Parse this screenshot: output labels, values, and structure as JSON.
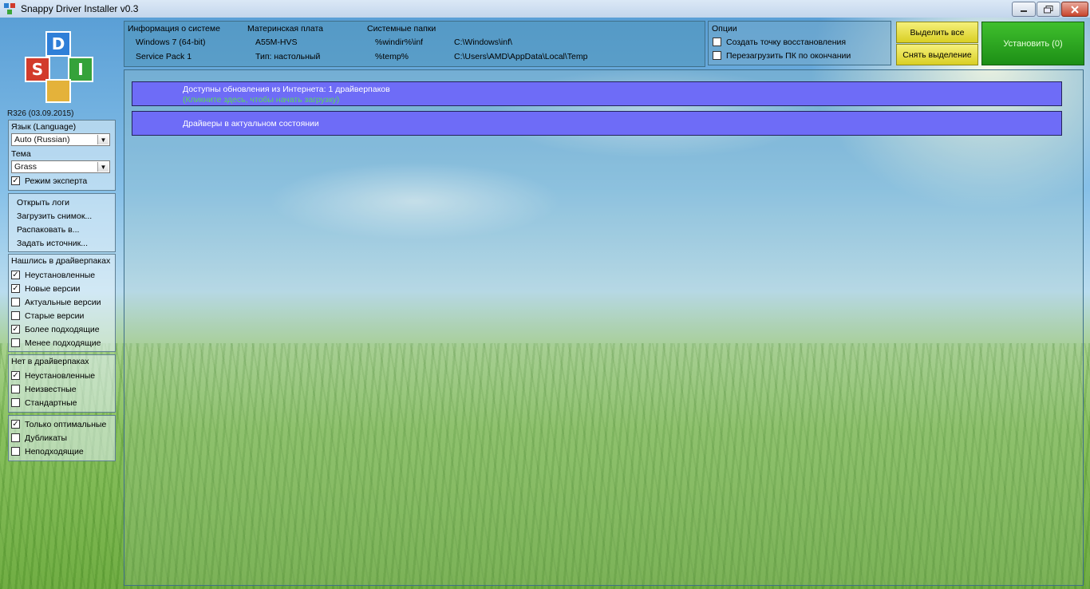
{
  "window": {
    "title": "Snappy Driver Installer v0.3",
    "controls": [
      "minimize",
      "maximize",
      "close"
    ]
  },
  "logo": {
    "letters": [
      "S",
      "D",
      "I"
    ],
    "version": "R326 (03.09.2015)"
  },
  "settings": {
    "language_label": "Язык (Language)",
    "language_value": "Auto (Russian)",
    "theme_label": "Тема",
    "theme_value": "Grass",
    "expert_mode": {
      "label": "Режим эксперта",
      "checked": true
    }
  },
  "actions": {
    "items": [
      "Открыть логи",
      "Загрузить снимок...",
      "Распаковать в...",
      "Задать источник..."
    ]
  },
  "found_in_packs": {
    "title": "Нашлись в драйверпаках",
    "items": [
      {
        "label": "Неустановленные",
        "checked": true
      },
      {
        "label": "Новые версии",
        "checked": true
      },
      {
        "label": "Актуальные версии",
        "checked": false
      },
      {
        "label": "Старые версии",
        "checked": false
      },
      {
        "label": "Более подходящие",
        "checked": true
      },
      {
        "label": "Менее подходящие",
        "checked": false
      }
    ]
  },
  "not_in_packs": {
    "title": "Нет в драйверпаках",
    "items": [
      {
        "label": "Неустановленные",
        "checked": true
      },
      {
        "label": "Неизвестные",
        "checked": false
      },
      {
        "label": "Стандартные",
        "checked": false
      }
    ]
  },
  "extra_filters": {
    "items": [
      {
        "label": "Только оптимальные",
        "checked": true
      },
      {
        "label": "Дубликаты",
        "checked": false
      },
      {
        "label": "Неподходящие",
        "checked": false
      }
    ]
  },
  "system_info": {
    "header_system": "Информация о системе",
    "os": "Windows 7 (64-bit)",
    "service_pack": "Service Pack 1",
    "header_board": "Материнская плата",
    "board": "A55M-HVS",
    "board_type": "Тип: настольный",
    "header_folders": "Системные папки",
    "var_windir": "%windir%\\inf",
    "path_windir": "C:\\Windows\\inf\\",
    "var_temp": "%temp%",
    "path_temp": "C:\\Users\\AMD\\AppData\\Local\\Temp"
  },
  "options": {
    "title": "Опции",
    "items": [
      {
        "label": "Создать точку восстановления",
        "checked": false
      },
      {
        "label": "Перезагрузить ПК по окончании",
        "checked": false
      }
    ]
  },
  "buttons": {
    "select_all": "Выделить все",
    "deselect": "Снять выделение",
    "install": "Установить (0)"
  },
  "status": {
    "update_title": "Доступны обновления из Интернета: 1 драйверпаков",
    "update_hint": "(Кликните здесь, чтобы начать загрузку)",
    "drivers_ok": "Драйверы в актуальном состоянии"
  },
  "colors": {
    "status_bar": "#6e6cf7",
    "install_button": "#2aa81f",
    "select_buttons": "#e8e04a",
    "hint_text": "#5bd85b"
  }
}
